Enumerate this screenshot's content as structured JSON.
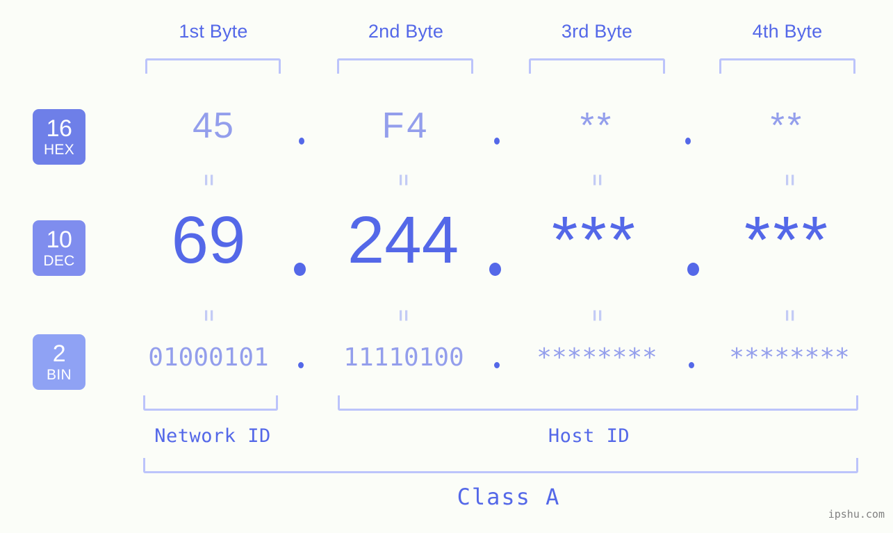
{
  "colors": {
    "background": "#fbfdf8",
    "accent_strong": "#5468e8",
    "accent_mid": "#939eec",
    "accent_light": "#bcc4fb",
    "accent_faint": "#c3cbf5",
    "badge_hex": "#6e7fe8",
    "badge_dec": "#7f8dee",
    "badge_bin": "#8fa2f4",
    "watermark": "#808080"
  },
  "header": {
    "byte_labels": [
      {
        "text": "1st Byte"
      },
      {
        "text": "2nd Byte"
      },
      {
        "text": "3rd Byte"
      },
      {
        "text": "4th Byte"
      }
    ]
  },
  "badges": [
    {
      "number": "16",
      "name": "HEX"
    },
    {
      "number": "10",
      "name": "DEC"
    },
    {
      "number": "2",
      "name": "BIN"
    }
  ],
  "rows": {
    "hex": {
      "values": [
        "45",
        "F4",
        "**",
        "**"
      ]
    },
    "dec": {
      "values": [
        "69",
        "244",
        "***",
        "***"
      ]
    },
    "bin": {
      "values": [
        "01000101",
        "11110100",
        "********",
        "********"
      ]
    }
  },
  "separators": {
    "glyph": ".",
    "count": 3
  },
  "equals": {
    "glyph": "=",
    "rows": 2,
    "per_row": 4
  },
  "footer": {
    "network_id_label": "Network ID",
    "host_id_label": "Host ID",
    "class_label": "Class A"
  },
  "watermark": {
    "text": "ipshu.com"
  }
}
